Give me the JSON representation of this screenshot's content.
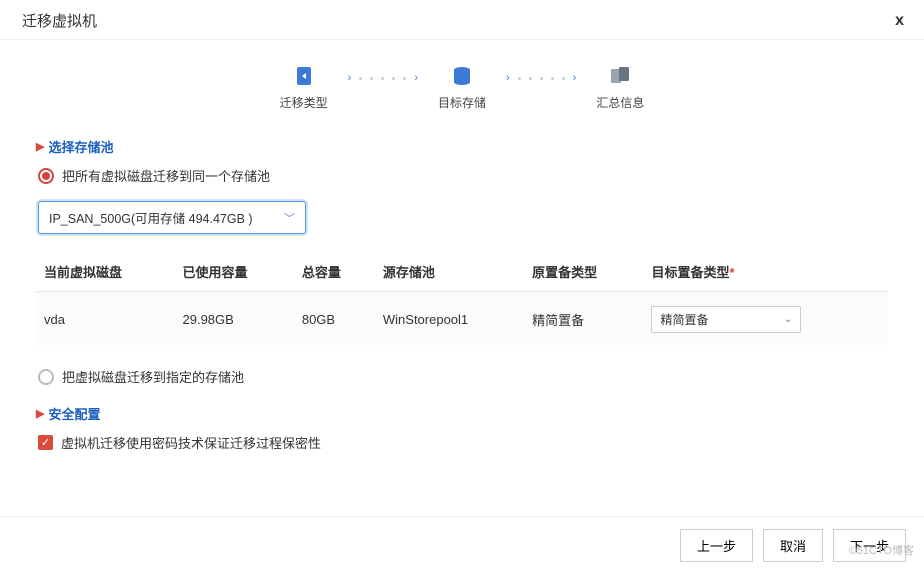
{
  "dialog": {
    "title": "迁移虚拟机",
    "close": "x"
  },
  "stepper": {
    "steps": [
      "迁移类型",
      "目标存储",
      "汇总信息"
    ]
  },
  "storage": {
    "section_title": "选择存储池",
    "radio_same_pool": "把所有虚拟磁盘迁移到同一个存储池",
    "pool_select_value": "IP_SAN_500G(可用存储 494.47GB )",
    "table": {
      "headers": {
        "disk": "当前虚拟磁盘",
        "used": "已使用容量",
        "total": "总容量",
        "src_pool": "源存储池",
        "src_type": "原置备类型",
        "dst_type": "目标置备类型"
      },
      "row": {
        "disk": "vda",
        "used": "29.98GB",
        "total": "80GB",
        "src_pool": "WinStorepool1",
        "src_type": "精简置备",
        "dst_type": "精简置备"
      }
    },
    "radio_diff_pool": "把虚拟磁盘迁移到指定的存储池"
  },
  "security": {
    "section_title": "安全配置",
    "checkbox_label": "虚拟机迁移使用密码技术保证迁移过程保密性"
  },
  "footer": {
    "prev": "上一步",
    "cancel": "取消",
    "next": "下一步"
  },
  "watermark": "©51CTO博客"
}
